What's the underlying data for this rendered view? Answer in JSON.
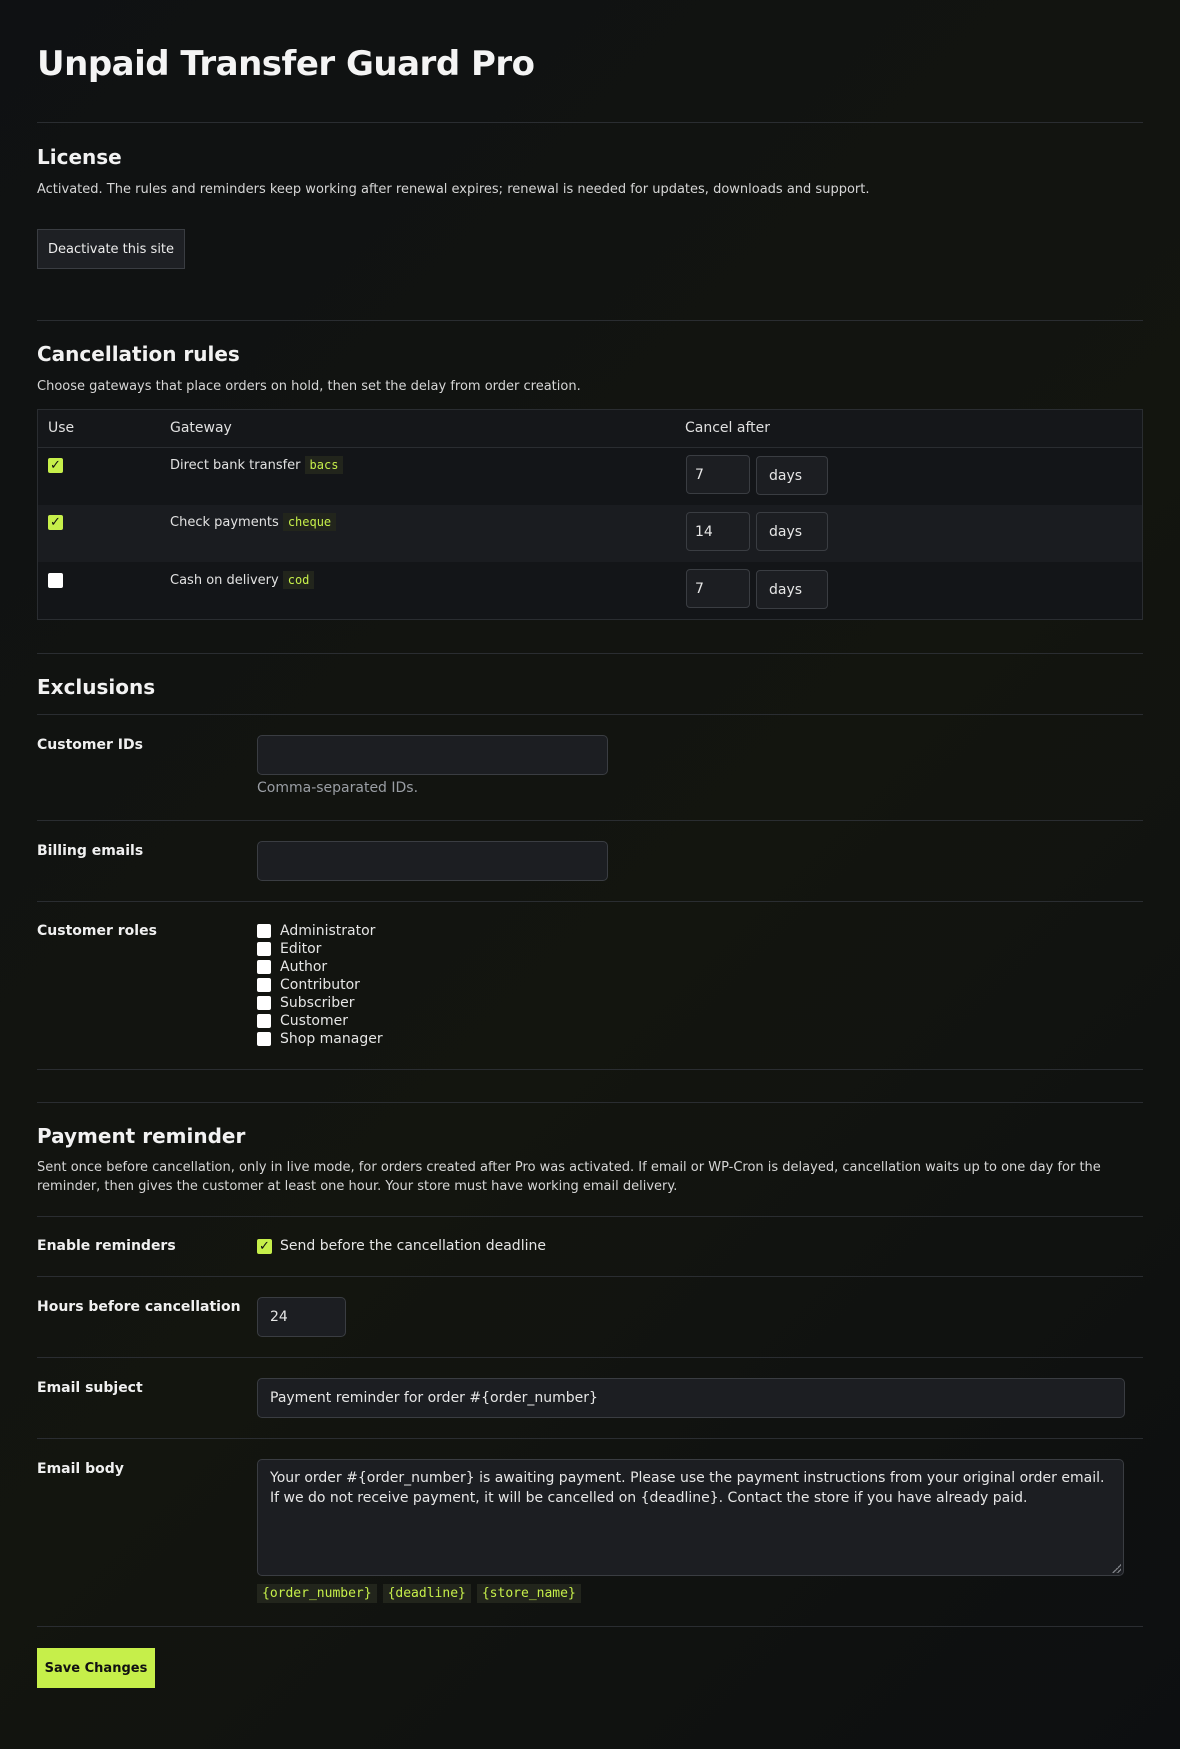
{
  "title": "Unpaid Transfer Guard Pro",
  "license": {
    "heading": "License",
    "description": "Activated. The rules and reminders keep working after renewal expires; renewal is needed for updates, downloads and support.",
    "deactivate_label": "Deactivate this site"
  },
  "cancellation": {
    "heading": "Cancellation rules",
    "description": "Choose gateways that place orders on hold, then set the delay from order creation.",
    "columns": {
      "use": "Use",
      "gateway": "Gateway",
      "cancel_after": "Cancel after"
    },
    "rows": [
      {
        "name": "Direct bank transfer",
        "code": "bacs",
        "checked": true,
        "amount": "7",
        "unit": "days"
      },
      {
        "name": "Check payments",
        "code": "cheque",
        "checked": true,
        "amount": "14",
        "unit": "days"
      },
      {
        "name": "Cash on delivery",
        "code": "cod",
        "checked": false,
        "amount": "7",
        "unit": "days"
      }
    ]
  },
  "exclusions": {
    "heading": "Exclusions",
    "customer_ids_label": "Customer IDs",
    "customer_ids_value": "",
    "customer_ids_help": "Comma-separated IDs.",
    "billing_emails_label": "Billing emails",
    "billing_emails_value": "",
    "customer_roles_label": "Customer roles",
    "roles": [
      {
        "label": "Administrator",
        "checked": false
      },
      {
        "label": "Editor",
        "checked": false
      },
      {
        "label": "Author",
        "checked": false
      },
      {
        "label": "Contributor",
        "checked": false
      },
      {
        "label": "Subscriber",
        "checked": false
      },
      {
        "label": "Customer",
        "checked": false
      },
      {
        "label": "Shop manager",
        "checked": false
      }
    ]
  },
  "reminder": {
    "heading": "Payment reminder",
    "description": "Sent once before cancellation, only in live mode, for orders created after Pro was activated. If email or WP-Cron is delayed, cancellation waits up to one day for the reminder, then gives the customer at least one hour. Your store must have working email delivery.",
    "enable_label": "Enable reminders",
    "enable_checkbox_label": "Send before the cancellation deadline",
    "enable_checked": true,
    "hours_label": "Hours before cancellation",
    "hours_value": "24",
    "subject_label": "Email subject",
    "subject_value": "Payment reminder for order #{order_number}",
    "body_label": "Email body",
    "body_value": "Your order #{order_number} is awaiting payment. Please use the payment instructions from your original order email. If we do not receive payment, it will be cancelled on {deadline}. Contact the store if you have already paid.",
    "placeholders": [
      "{order_number}",
      "{deadline}",
      "{store_name}"
    ]
  },
  "save_label": "Save Changes",
  "colors": {
    "accent": "#c6ef4a",
    "background": "#0d0f11",
    "panel": "#1c1e22"
  }
}
